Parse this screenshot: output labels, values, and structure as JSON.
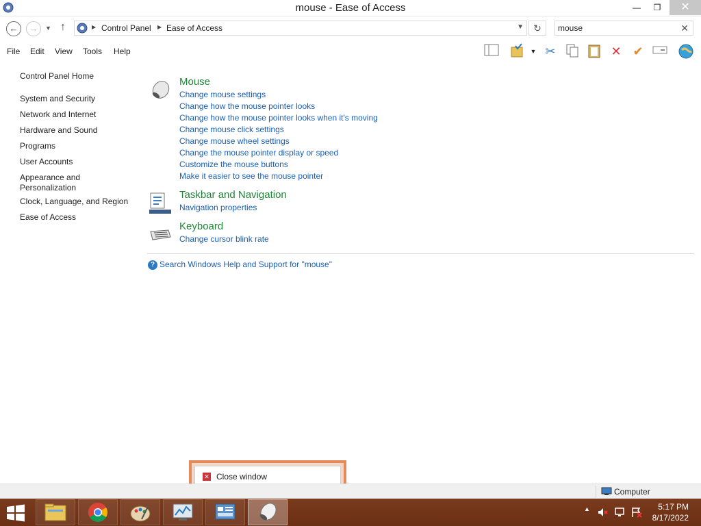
{
  "window": {
    "title": "mouse - Ease of Access",
    "minimize_glyph": "—",
    "maximize_glyph": "❐",
    "close_glyph": "✕"
  },
  "address_bar": {
    "breadcrumbs": [
      "Control Panel",
      "Ease of Access"
    ],
    "search_value": "mouse"
  },
  "menu": [
    "File",
    "Edit",
    "View",
    "Tools",
    "Help"
  ],
  "toolbar_icons": [
    "layout-icon",
    "properties-folder-icon",
    "cut-icon",
    "copy-icon",
    "paste-icon",
    "delete-icon",
    "check-icon",
    "rename-icon",
    "globe-icon"
  ],
  "left_nav": {
    "home": "Control Panel Home",
    "items": [
      "System and Security",
      "Network and Internet",
      "Hardware and Sound",
      "Programs",
      "User Accounts",
      "Appearance and Personalization",
      "Clock, Language, and Region",
      "Ease of Access"
    ]
  },
  "results": [
    {
      "title": "Mouse",
      "icon": "mouse-icon",
      "links": [
        "Change mouse settings",
        "Change how the mouse pointer looks",
        "Change how the mouse pointer looks when it's moving",
        "Change mouse click settings",
        "Change mouse wheel settings",
        "Change the mouse pointer display or speed",
        "Customize the mouse buttons",
        "Make it easier to see the mouse pointer"
      ]
    },
    {
      "title": "Taskbar and Navigation",
      "icon": "taskbar-icon",
      "links": [
        "Navigation properties"
      ]
    },
    {
      "title": "Keyboard",
      "icon": "keyboard-icon",
      "links": [
        "Change cursor blink rate"
      ]
    }
  ],
  "help_link": "Search Windows Help and Support for \"mouse\"",
  "popup": {
    "label": "Close window"
  },
  "status_bar": {
    "location": "Computer"
  },
  "taskbar": {
    "apps": [
      "file-explorer-icon",
      "chrome-icon",
      "paint-icon",
      "resource-monitor-icon",
      "control-panel-icon",
      "mouse-icon"
    ],
    "active_app": "mouse-icon",
    "time": "5:17 PM",
    "date": "8/17/2022"
  },
  "colors": {
    "link": "#1a5fb4",
    "group_title": "#1e8536",
    "taskbar": "#6b2f14",
    "popup_border": "#e58a5b"
  }
}
